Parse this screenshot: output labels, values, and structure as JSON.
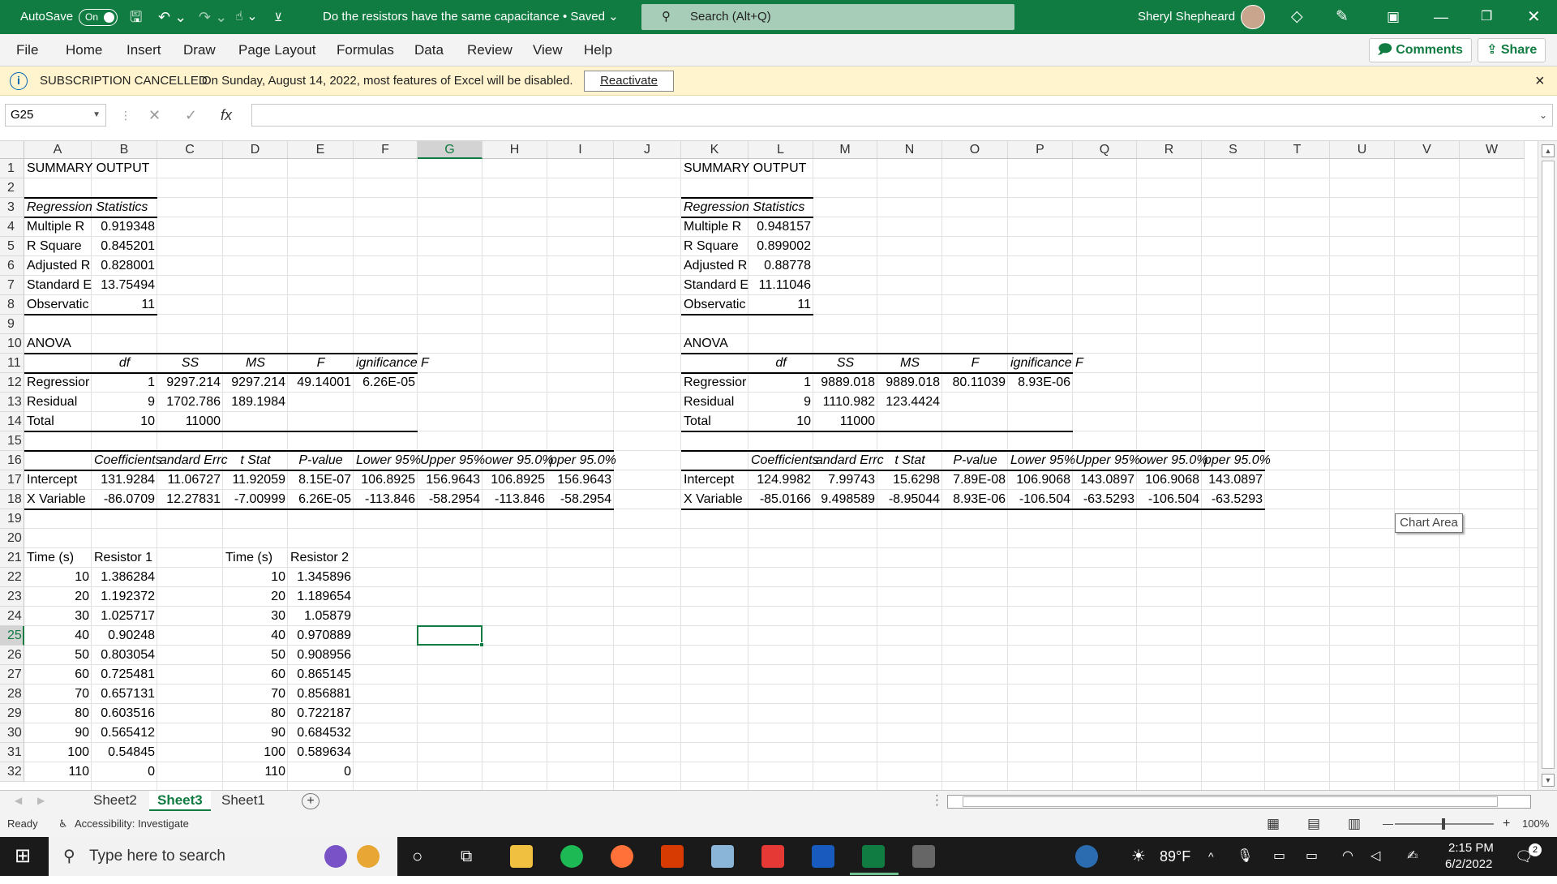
{
  "titlebar": {
    "autosave": "AutoSave",
    "toggle": "On",
    "doc_title": "Do the resistors have the same capacitance • Saved ⌄",
    "search_placeholder": "Search (Alt+Q)",
    "user": "Sheryl Shepheard"
  },
  "menu": {
    "items": [
      "File",
      "Home",
      "Insert",
      "Draw",
      "Page Layout",
      "Formulas",
      "Data",
      "Review",
      "View",
      "Help"
    ],
    "comments": "Comments",
    "share": "Share"
  },
  "message": {
    "title": "SUBSCRIPTION CANCELLED",
    "text": "On Sunday, August 14, 2022, most features of Excel will be disabled.",
    "button": "Reactivate",
    "close": "×"
  },
  "formula": {
    "namebox": "G25",
    "fx": "fx",
    "content": ""
  },
  "columns": [
    "A",
    "B",
    "C",
    "D",
    "E",
    "F",
    "G",
    "H",
    "I",
    "J",
    "K",
    "L",
    "M",
    "N",
    "O",
    "P",
    "Q",
    "R",
    "S",
    "T",
    "U",
    "V",
    "W"
  ],
  "rows": [
    "1",
    "2",
    "3",
    "4",
    "5",
    "6",
    "7",
    "8",
    "9",
    "10",
    "11",
    "12",
    "13",
    "14",
    "15",
    "16",
    "17",
    "18",
    "19",
    "20",
    "21",
    "22",
    "23",
    "24",
    "25",
    "26",
    "27",
    "28",
    "29",
    "30",
    "31",
    "32"
  ],
  "cells": [
    {
      "c": "A",
      "r": 1,
      "v": "SUMMARY OUTPUT"
    },
    {
      "c": "A",
      "r": 3,
      "v": "Regression Statistics",
      "s": "i"
    },
    {
      "c": "A",
      "r": 4,
      "v": "Multiple R"
    },
    {
      "c": "B",
      "r": 4,
      "v": "0.919348",
      "s": "r"
    },
    {
      "c": "A",
      "r": 5,
      "v": "R Square"
    },
    {
      "c": "B",
      "r": 5,
      "v": "0.845201",
      "s": "r"
    },
    {
      "c": "A",
      "r": 6,
      "v": "Adjusted R"
    },
    {
      "c": "B",
      "r": 6,
      "v": "0.828001",
      "s": "r"
    },
    {
      "c": "A",
      "r": 7,
      "v": "Standard E"
    },
    {
      "c": "B",
      "r": 7,
      "v": "13.75494",
      "s": "r"
    },
    {
      "c": "A",
      "r": 8,
      "v": "Observatic"
    },
    {
      "c": "B",
      "r": 8,
      "v": "11",
      "s": "r"
    },
    {
      "c": "A",
      "r": 10,
      "v": "ANOVA"
    },
    {
      "c": "B",
      "r": 11,
      "v": "df",
      "s": "ic"
    },
    {
      "c": "C",
      "r": 11,
      "v": "SS",
      "s": "ic"
    },
    {
      "c": "D",
      "r": 11,
      "v": "MS",
      "s": "ic"
    },
    {
      "c": "E",
      "r": 11,
      "v": "F",
      "s": "ic"
    },
    {
      "c": "F",
      "r": 11,
      "v": "ignificance F",
      "s": "i"
    },
    {
      "c": "A",
      "r": 12,
      "v": "Regressior"
    },
    {
      "c": "B",
      "r": 12,
      "v": "1",
      "s": "r"
    },
    {
      "c": "C",
      "r": 12,
      "v": "9297.214",
      "s": "r"
    },
    {
      "c": "D",
      "r": 12,
      "v": "9297.214",
      "s": "r"
    },
    {
      "c": "E",
      "r": 12,
      "v": "49.14001",
      "s": "r"
    },
    {
      "c": "F",
      "r": 12,
      "v": "6.26E-05",
      "s": "r"
    },
    {
      "c": "A",
      "r": 13,
      "v": "Residual"
    },
    {
      "c": "B",
      "r": 13,
      "v": "9",
      "s": "r"
    },
    {
      "c": "C",
      "r": 13,
      "v": "1702.786",
      "s": "r"
    },
    {
      "c": "D",
      "r": 13,
      "v": "189.1984",
      "s": "r"
    },
    {
      "c": "A",
      "r": 14,
      "v": "Total"
    },
    {
      "c": "B",
      "r": 14,
      "v": "10",
      "s": "r"
    },
    {
      "c": "C",
      "r": 14,
      "v": "11000",
      "s": "r"
    },
    {
      "c": "B",
      "r": 16,
      "v": "Coefficients",
      "s": "i"
    },
    {
      "c": "C",
      "r": 16,
      "v": "andard Errc",
      "s": "i"
    },
    {
      "c": "D",
      "r": 16,
      "v": "t Stat",
      "s": "ic"
    },
    {
      "c": "E",
      "r": 16,
      "v": "P-value",
      "s": "ic"
    },
    {
      "c": "F",
      "r": 16,
      "v": "Lower 95%",
      "s": "i"
    },
    {
      "c": "G",
      "r": 16,
      "v": "Upper 95%",
      "s": "i"
    },
    {
      "c": "H",
      "r": 16,
      "v": "ower 95.0%",
      "s": "i"
    },
    {
      "c": "I",
      "r": 16,
      "v": "pper 95.0%",
      "s": "i"
    },
    {
      "c": "A",
      "r": 17,
      "v": "Intercept"
    },
    {
      "c": "B",
      "r": 17,
      "v": "131.9284",
      "s": "r"
    },
    {
      "c": "C",
      "r": 17,
      "v": "11.06727",
      "s": "r"
    },
    {
      "c": "D",
      "r": 17,
      "v": "11.92059",
      "s": "r"
    },
    {
      "c": "E",
      "r": 17,
      "v": "8.15E-07",
      "s": "r"
    },
    {
      "c": "F",
      "r": 17,
      "v": "106.8925",
      "s": "r"
    },
    {
      "c": "G",
      "r": 17,
      "v": "156.9643",
      "s": "r"
    },
    {
      "c": "H",
      "r": 17,
      "v": "106.8925",
      "s": "r"
    },
    {
      "c": "I",
      "r": 17,
      "v": "156.9643",
      "s": "r"
    },
    {
      "c": "A",
      "r": 18,
      "v": "X Variable"
    },
    {
      "c": "B",
      "r": 18,
      "v": "-86.0709",
      "s": "r"
    },
    {
      "c": "C",
      "r": 18,
      "v": "12.27831",
      "s": "r"
    },
    {
      "c": "D",
      "r": 18,
      "v": "-7.00999",
      "s": "r"
    },
    {
      "c": "E",
      "r": 18,
      "v": "6.26E-05",
      "s": "r"
    },
    {
      "c": "F",
      "r": 18,
      "v": "-113.846",
      "s": "r"
    },
    {
      "c": "G",
      "r": 18,
      "v": "-58.2954",
      "s": "r"
    },
    {
      "c": "H",
      "r": 18,
      "v": "-113.846",
      "s": "r"
    },
    {
      "c": "I",
      "r": 18,
      "v": "-58.2954",
      "s": "r"
    },
    {
      "c": "A",
      "r": 21,
      "v": "Time (s)"
    },
    {
      "c": "B",
      "r": 21,
      "v": "Resistor 1"
    },
    {
      "c": "D",
      "r": 21,
      "v": "Time (s)"
    },
    {
      "c": "E",
      "r": 21,
      "v": "Resistor 2"
    },
    {
      "c": "A",
      "r": 22,
      "v": "10",
      "s": "r"
    },
    {
      "c": "B",
      "r": 22,
      "v": "1.386284",
      "s": "r"
    },
    {
      "c": "D",
      "r": 22,
      "v": "10",
      "s": "r"
    },
    {
      "c": "E",
      "r": 22,
      "v": "1.345896",
      "s": "r"
    },
    {
      "c": "A",
      "r": 23,
      "v": "20",
      "s": "r"
    },
    {
      "c": "B",
      "r": 23,
      "v": "1.192372",
      "s": "r"
    },
    {
      "c": "D",
      "r": 23,
      "v": "20",
      "s": "r"
    },
    {
      "c": "E",
      "r": 23,
      "v": "1.189654",
      "s": "r"
    },
    {
      "c": "A",
      "r": 24,
      "v": "30",
      "s": "r"
    },
    {
      "c": "B",
      "r": 24,
      "v": "1.025717",
      "s": "r"
    },
    {
      "c": "D",
      "r": 24,
      "v": "30",
      "s": "r"
    },
    {
      "c": "E",
      "r": 24,
      "v": "1.05879",
      "s": "r"
    },
    {
      "c": "A",
      "r": 25,
      "v": "40",
      "s": "r"
    },
    {
      "c": "B",
      "r": 25,
      "v": "0.90248",
      "s": "r"
    },
    {
      "c": "D",
      "r": 25,
      "v": "40",
      "s": "r"
    },
    {
      "c": "E",
      "r": 25,
      "v": "0.970889",
      "s": "r"
    },
    {
      "c": "A",
      "r": 26,
      "v": "50",
      "s": "r"
    },
    {
      "c": "B",
      "r": 26,
      "v": "0.803054",
      "s": "r"
    },
    {
      "c": "D",
      "r": 26,
      "v": "50",
      "s": "r"
    },
    {
      "c": "E",
      "r": 26,
      "v": "0.908956",
      "s": "r"
    },
    {
      "c": "A",
      "r": 27,
      "v": "60",
      "s": "r"
    },
    {
      "c": "B",
      "r": 27,
      "v": "0.725481",
      "s": "r"
    },
    {
      "c": "D",
      "r": 27,
      "v": "60",
      "s": "r"
    },
    {
      "c": "E",
      "r": 27,
      "v": "0.865145",
      "s": "r"
    },
    {
      "c": "A",
      "r": 28,
      "v": "70",
      "s": "r"
    },
    {
      "c": "B",
      "r": 28,
      "v": "0.657131",
      "s": "r"
    },
    {
      "c": "D",
      "r": 28,
      "v": "70",
      "s": "r"
    },
    {
      "c": "E",
      "r": 28,
      "v": "0.856881",
      "s": "r"
    },
    {
      "c": "A",
      "r": 29,
      "v": "80",
      "s": "r"
    },
    {
      "c": "B",
      "r": 29,
      "v": "0.603516",
      "s": "r"
    },
    {
      "c": "D",
      "r": 29,
      "v": "80",
      "s": "r"
    },
    {
      "c": "E",
      "r": 29,
      "v": "0.722187",
      "s": "r"
    },
    {
      "c": "A",
      "r": 30,
      "v": "90",
      "s": "r"
    },
    {
      "c": "B",
      "r": 30,
      "v": "0.565412",
      "s": "r"
    },
    {
      "c": "D",
      "r": 30,
      "v": "90",
      "s": "r"
    },
    {
      "c": "E",
      "r": 30,
      "v": "0.684532",
      "s": "r"
    },
    {
      "c": "A",
      "r": 31,
      "v": "100",
      "s": "r"
    },
    {
      "c": "B",
      "r": 31,
      "v": "0.54845",
      "s": "r"
    },
    {
      "c": "D",
      "r": 31,
      "v": "100",
      "s": "r"
    },
    {
      "c": "E",
      "r": 31,
      "v": "0.589634",
      "s": "r"
    },
    {
      "c": "A",
      "r": 32,
      "v": "110",
      "s": "r"
    },
    {
      "c": "B",
      "r": 32,
      "v": "0",
      "s": "r"
    },
    {
      "c": "D",
      "r": 32,
      "v": "110",
      "s": "r"
    },
    {
      "c": "E",
      "r": 32,
      "v": "0",
      "s": "r"
    },
    {
      "c": "K",
      "r": 1,
      "v": "SUMMARY OUTPUT"
    },
    {
      "c": "K",
      "r": 3,
      "v": "Regression Statistics",
      "s": "i"
    },
    {
      "c": "K",
      "r": 4,
      "v": "Multiple R"
    },
    {
      "c": "L",
      "r": 4,
      "v": "0.948157",
      "s": "r"
    },
    {
      "c": "K",
      "r": 5,
      "v": "R Square"
    },
    {
      "c": "L",
      "r": 5,
      "v": "0.899002",
      "s": "r"
    },
    {
      "c": "K",
      "r": 6,
      "v": "Adjusted R"
    },
    {
      "c": "L",
      "r": 6,
      "v": "0.88778",
      "s": "r"
    },
    {
      "c": "K",
      "r": 7,
      "v": "Standard E"
    },
    {
      "c": "L",
      "r": 7,
      "v": "11.11046",
      "s": "r"
    },
    {
      "c": "K",
      "r": 8,
      "v": "Observatic"
    },
    {
      "c": "L",
      "r": 8,
      "v": "11",
      "s": "r"
    },
    {
      "c": "K",
      "r": 10,
      "v": "ANOVA"
    },
    {
      "c": "L",
      "r": 11,
      "v": "df",
      "s": "ic"
    },
    {
      "c": "M",
      "r": 11,
      "v": "SS",
      "s": "ic"
    },
    {
      "c": "N",
      "r": 11,
      "v": "MS",
      "s": "ic"
    },
    {
      "c": "O",
      "r": 11,
      "v": "F",
      "s": "ic"
    },
    {
      "c": "P",
      "r": 11,
      "v": "ignificance F",
      "s": "i"
    },
    {
      "c": "K",
      "r": 12,
      "v": "Regressior"
    },
    {
      "c": "L",
      "r": 12,
      "v": "1",
      "s": "r"
    },
    {
      "c": "M",
      "r": 12,
      "v": "9889.018",
      "s": "r"
    },
    {
      "c": "N",
      "r": 12,
      "v": "9889.018",
      "s": "r"
    },
    {
      "c": "O",
      "r": 12,
      "v": "80.11039",
      "s": "r"
    },
    {
      "c": "P",
      "r": 12,
      "v": "8.93E-06",
      "s": "r"
    },
    {
      "c": "K",
      "r": 13,
      "v": "Residual"
    },
    {
      "c": "L",
      "r": 13,
      "v": "9",
      "s": "r"
    },
    {
      "c": "M",
      "r": 13,
      "v": "1110.982",
      "s": "r"
    },
    {
      "c": "N",
      "r": 13,
      "v": "123.4424",
      "s": "r"
    },
    {
      "c": "K",
      "r": 14,
      "v": "Total"
    },
    {
      "c": "L",
      "r": 14,
      "v": "10",
      "s": "r"
    },
    {
      "c": "M",
      "r": 14,
      "v": "11000",
      "s": "r"
    },
    {
      "c": "L",
      "r": 16,
      "v": "Coefficients",
      "s": "i"
    },
    {
      "c": "M",
      "r": 16,
      "v": "andard Errc",
      "s": "i"
    },
    {
      "c": "N",
      "r": 16,
      "v": "t Stat",
      "s": "ic"
    },
    {
      "c": "O",
      "r": 16,
      "v": "P-value",
      "s": "ic"
    },
    {
      "c": "P",
      "r": 16,
      "v": "Lower 95%",
      "s": "i"
    },
    {
      "c": "Q",
      "r": 16,
      "v": "Upper 95%",
      "s": "i"
    },
    {
      "c": "R",
      "r": 16,
      "v": "ower 95.0%",
      "s": "i"
    },
    {
      "c": "S",
      "r": 16,
      "v": "pper 95.0%",
      "s": "i"
    },
    {
      "c": "K",
      "r": 17,
      "v": "Intercept"
    },
    {
      "c": "L",
      "r": 17,
      "v": "124.9982",
      "s": "r"
    },
    {
      "c": "M",
      "r": 17,
      "v": "7.99743",
      "s": "r"
    },
    {
      "c": "N",
      "r": 17,
      "v": "15.6298",
      "s": "r"
    },
    {
      "c": "O",
      "r": 17,
      "v": "7.89E-08",
      "s": "r"
    },
    {
      "c": "P",
      "r": 17,
      "v": "106.9068",
      "s": "r"
    },
    {
      "c": "Q",
      "r": 17,
      "v": "143.0897",
      "s": "r"
    },
    {
      "c": "R",
      "r": 17,
      "v": "106.9068",
      "s": "r"
    },
    {
      "c": "S",
      "r": 17,
      "v": "143.0897",
      "s": "r"
    },
    {
      "c": "K",
      "r": 18,
      "v": "X Variable"
    },
    {
      "c": "L",
      "r": 18,
      "v": "-85.0166",
      "s": "r"
    },
    {
      "c": "M",
      "r": 18,
      "v": "9.498589",
      "s": "r"
    },
    {
      "c": "N",
      "r": 18,
      "v": "-8.95044",
      "s": "r"
    },
    {
      "c": "O",
      "r": 18,
      "v": "8.93E-06",
      "s": "r"
    },
    {
      "c": "P",
      "r": 18,
      "v": "-106.504",
      "s": "r"
    },
    {
      "c": "Q",
      "r": 18,
      "v": "-63.5293",
      "s": "r"
    },
    {
      "c": "R",
      "r": 18,
      "v": "-106.504",
      "s": "r"
    },
    {
      "c": "S",
      "r": 18,
      "v": "-63.5293",
      "s": "r"
    }
  ],
  "chart_tooltip": "Chart Area",
  "tabs": {
    "items": [
      "Sheet2",
      "Sheet3",
      "Sheet1"
    ],
    "active": "Sheet3",
    "add": "+"
  },
  "status": {
    "ready": "Ready",
    "accessibility": "Accessibility: Investigate",
    "zoom": "100%"
  },
  "taskbar": {
    "search_placeholder": "Type here to search",
    "weather": "89°F",
    "time": "2:15 PM",
    "date": "6/2/2022",
    "notifications": "2"
  }
}
